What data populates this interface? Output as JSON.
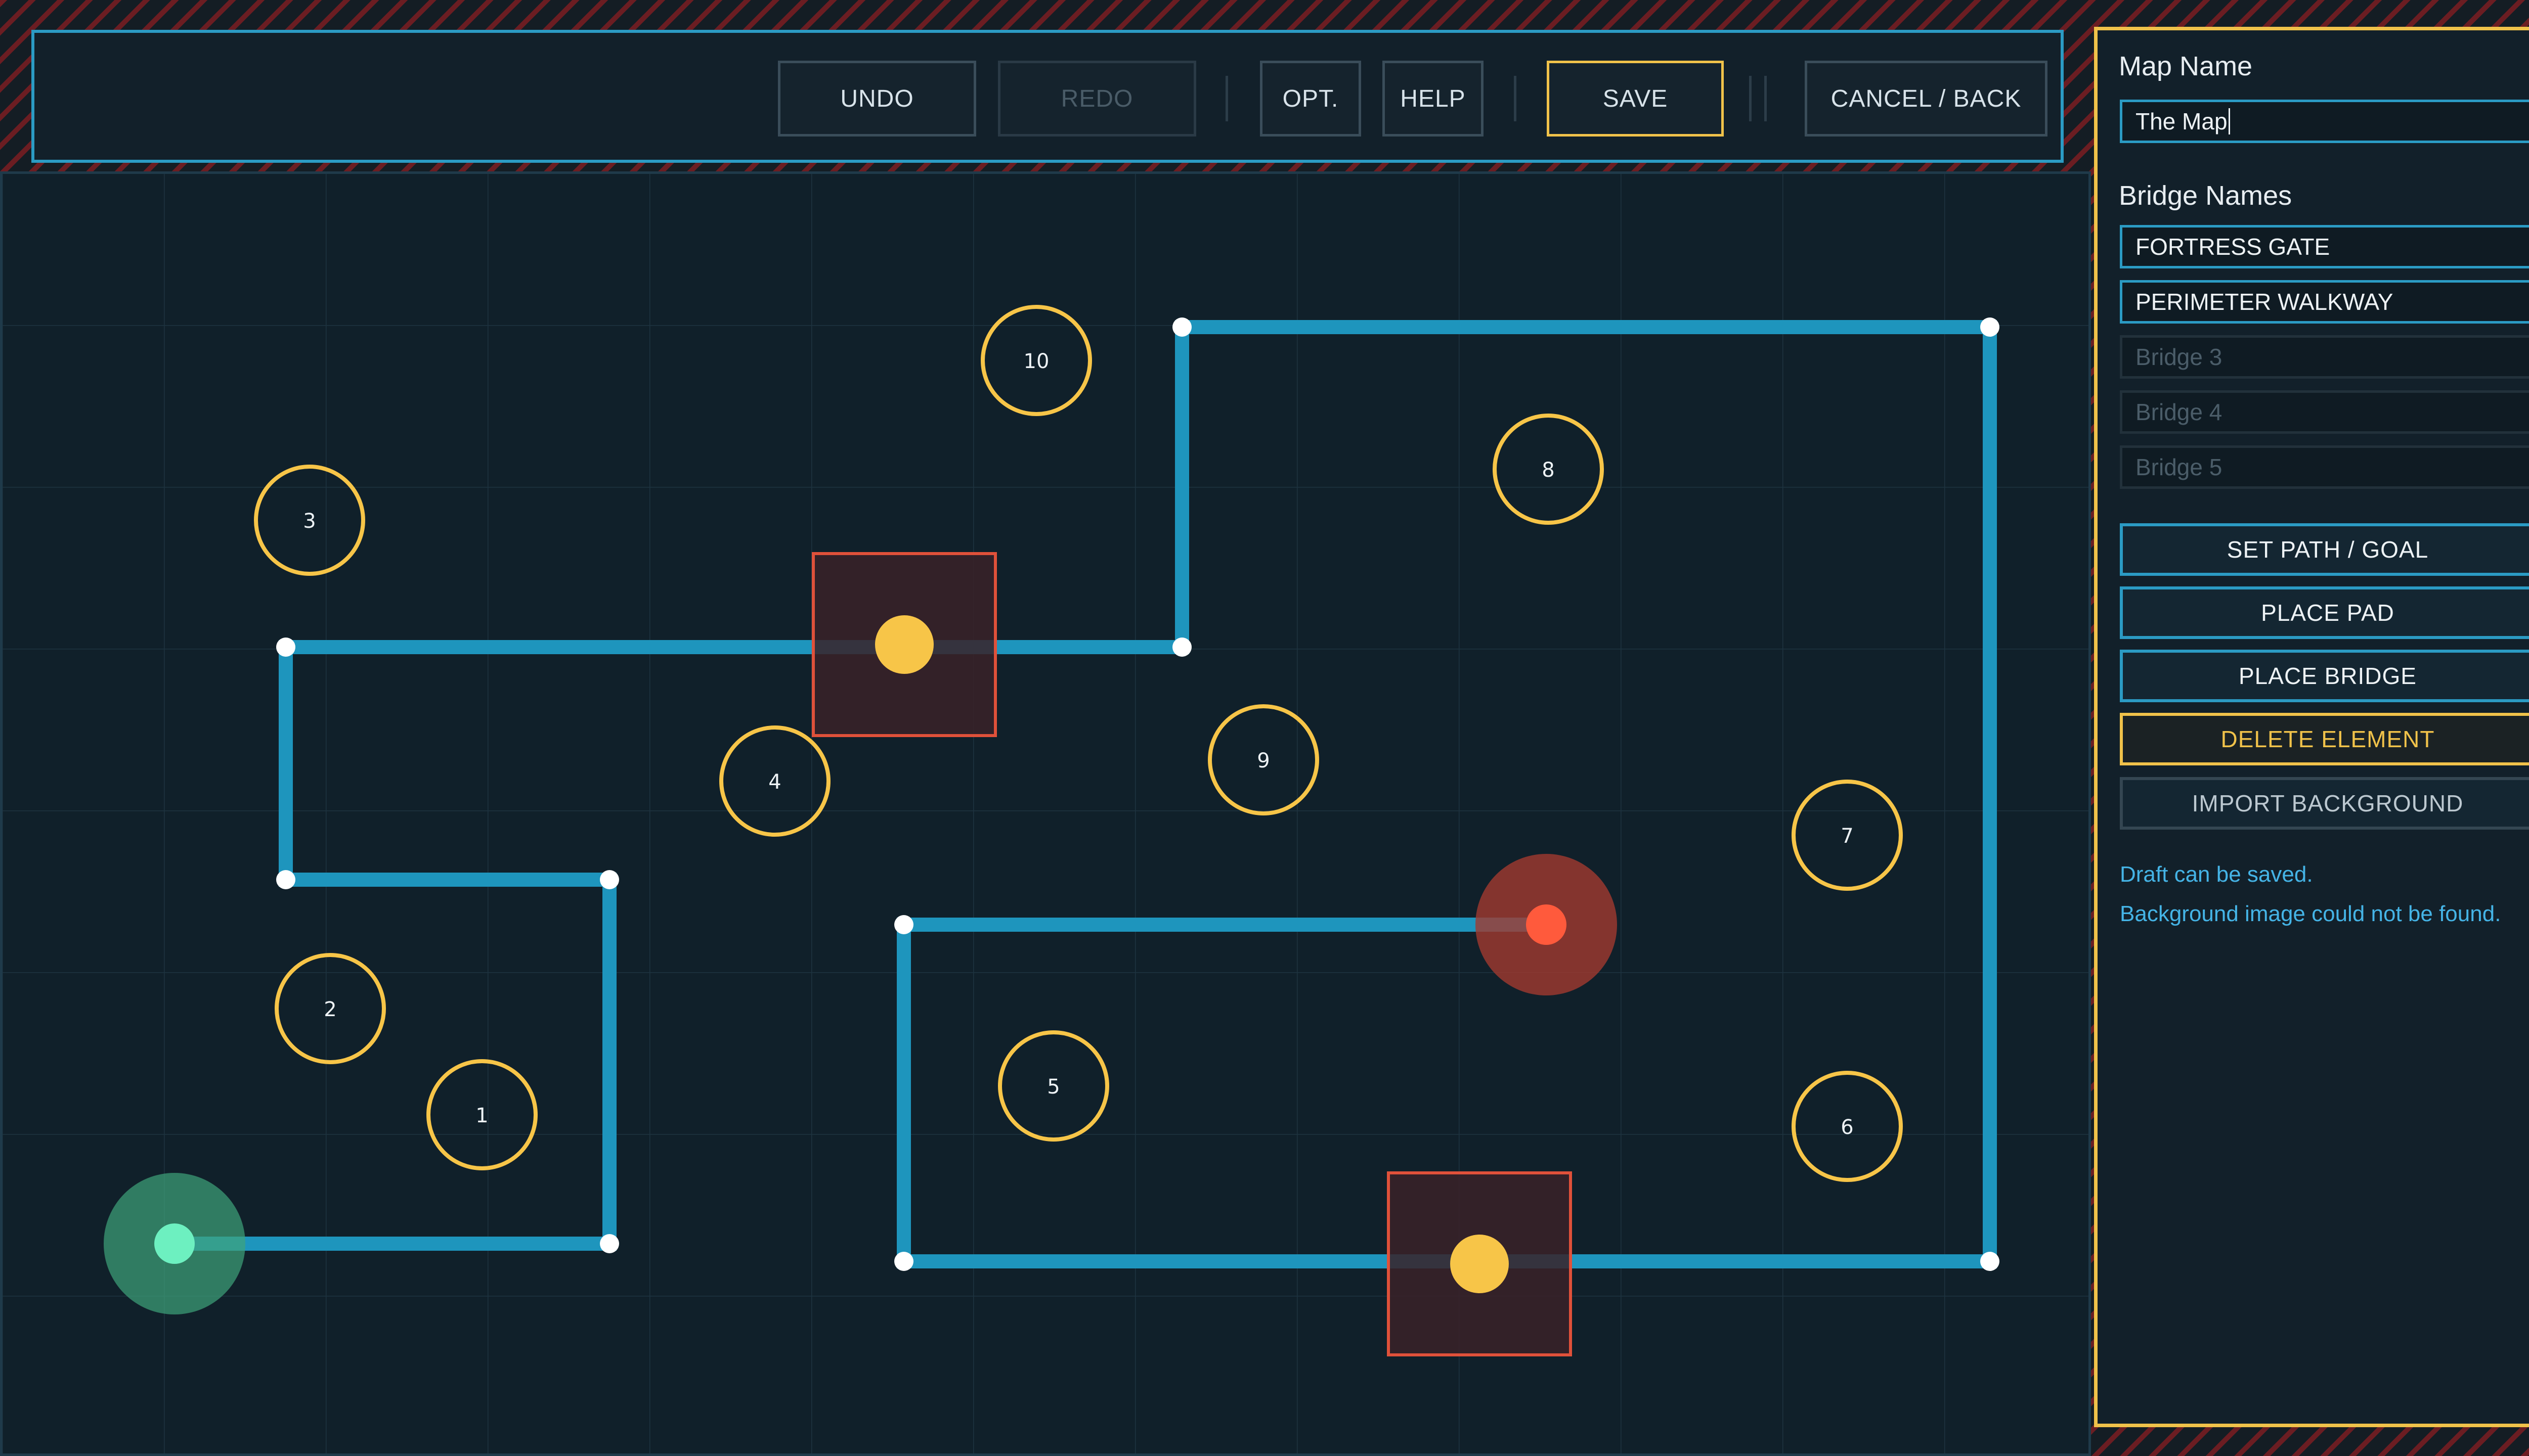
{
  "toolbar": {
    "undo": "UNDO",
    "redo": "REDO",
    "opt": "OPT.",
    "help": "HELP",
    "save": "SAVE",
    "cancel": "CANCEL / BACK"
  },
  "panel": {
    "map_name_label": "Map Name",
    "map_name_value": "The Map",
    "bridge_names_label": "Bridge Names",
    "bridges": [
      {
        "value": "FORTRESS GATE",
        "placeholder": ""
      },
      {
        "value": "PERIMETER WALKWAY",
        "placeholder": ""
      },
      {
        "value": "",
        "placeholder": "Bridge 3"
      },
      {
        "value": "",
        "placeholder": "Bridge 4"
      },
      {
        "value": "",
        "placeholder": "Bridge 5"
      }
    ],
    "buttons": {
      "set_path": "SET PATH / GOAL",
      "place_pad": "PLACE PAD",
      "place_bridge": "PLACE BRIDGE",
      "delete": "DELETE ELEMENT",
      "import_bg": "IMPORT BACKGROUND"
    },
    "status": [
      "Draft can be saved.",
      "Background image could not be found."
    ]
  },
  "board": {
    "pads": [
      "1",
      "2",
      "3",
      "4",
      "5",
      "6",
      "7",
      "8",
      "9",
      "10"
    ]
  },
  "colors": {
    "path": "#1e95bd",
    "pad_ring": "#f7c548",
    "bridge": "#f7c548",
    "start": "#6df0c0",
    "goal": "#ff5a3c",
    "accent": "#2b9bc4",
    "hazard": "#6b1d22"
  }
}
